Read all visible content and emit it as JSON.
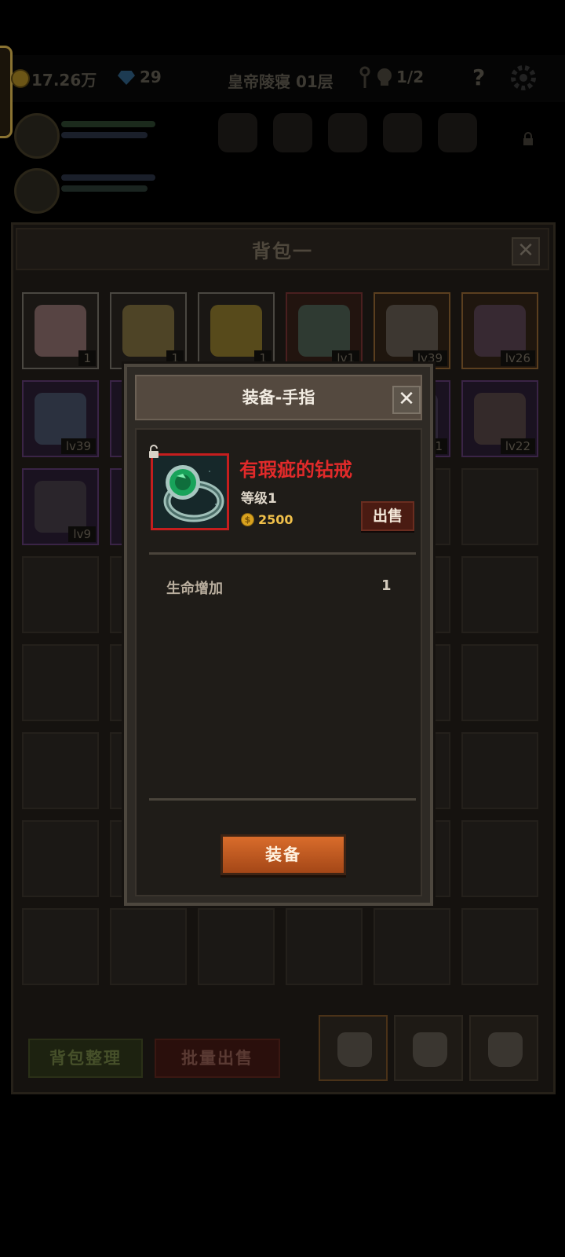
{
  "hud": {
    "gold": "17.26万",
    "gems": "29",
    "location": "皇帝陵寝 01层",
    "keys": "1/2",
    "help": "?"
  },
  "backpack": {
    "title": "背包一",
    "close": "✕",
    "items": [
      {
        "label": "1",
        "rarity": "gray",
        "icon": "cake-icon",
        "color": "#8a6a6a"
      },
      {
        "label": "1",
        "rarity": "gray",
        "icon": "beer-mug-icon",
        "color": "#7a6a34"
      },
      {
        "label": "1",
        "rarity": "gray",
        "icon": "cheese-icon",
        "color": "#8a7420"
      },
      {
        "label": "lv1",
        "rarity": "red",
        "icon": "ring-icon",
        "color": "#3a5a50"
      },
      {
        "label": "lv39",
        "rarity": "orange",
        "icon": "sword-icon",
        "color": "#56534e"
      },
      {
        "label": "lv26",
        "rarity": "orange",
        "icon": "bow-icon",
        "color": "#4a3a50"
      },
      {
        "label": "lv39",
        "rarity": "purple",
        "icon": "shield-icon",
        "color": "#3b4a5a"
      },
      {
        "label": "",
        "rarity": "purple",
        "icon": "item-icon",
        "color": "#3a3346"
      },
      {
        "label": "",
        "rarity": "empty",
        "icon": "",
        "color": ""
      },
      {
        "label": "",
        "rarity": "empty",
        "icon": "",
        "color": ""
      },
      {
        "label": "1",
        "rarity": "purple",
        "icon": "item-icon",
        "color": "#3a3346"
      },
      {
        "label": "lv22",
        "rarity": "purple",
        "icon": "helmet-icon",
        "color": "#4a3e33"
      },
      {
        "label": "lv9",
        "rarity": "purple",
        "icon": "gun-icon",
        "color": "#383535"
      },
      {
        "label": "",
        "rarity": "purple",
        "icon": "item-icon",
        "color": "#3a3346"
      }
    ],
    "sort_button": "背包整理",
    "batch_sell_button": "批量出售"
  },
  "dialog": {
    "title": "装备-手指",
    "close": "✕",
    "item_name": "有瑕疵的钻戒",
    "item_level": "等级1",
    "price": "2500",
    "coin_symbol": "$",
    "sell_button": "出售",
    "stats": [
      {
        "name": "生命增加",
        "value": "1"
      }
    ],
    "equip_button": "装备"
  },
  "colors": {
    "item_name": "#e12a2a",
    "equip_button": "#c8602a",
    "price": "#f0c04a"
  }
}
